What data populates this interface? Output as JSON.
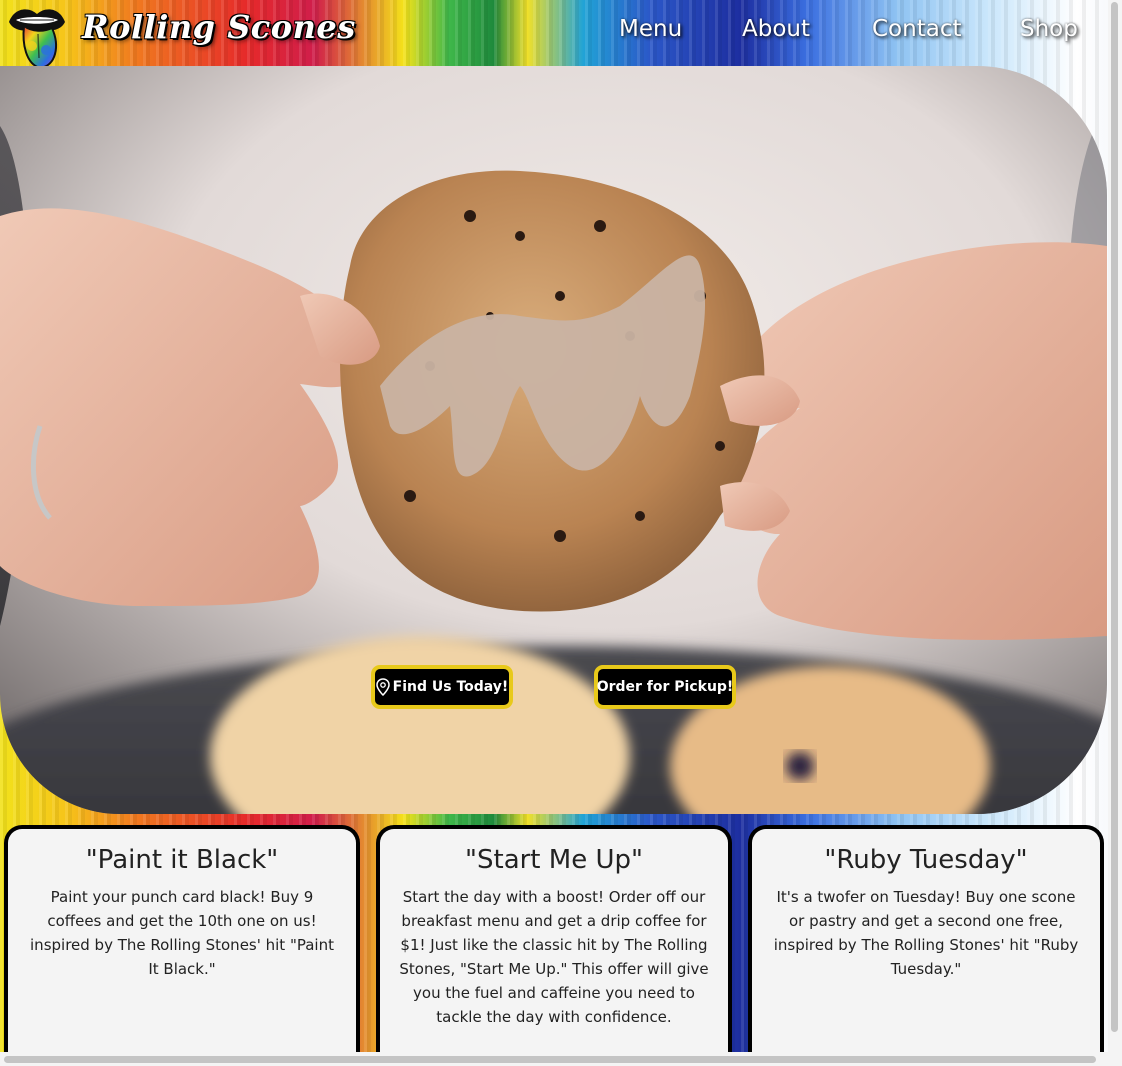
{
  "brand": {
    "name": "Rolling Scones",
    "logo_icon": "rainbow-tongue-logo-icon"
  },
  "nav": {
    "items": [
      {
        "label": "Menu"
      },
      {
        "label": "About"
      },
      {
        "label": "Contact"
      },
      {
        "label": "Shop"
      }
    ]
  },
  "hero": {
    "image": "hands-breaking-glazed-scone-photo",
    "find_button": {
      "label": "Find Us Today!",
      "icon": "map-pin-icon"
    },
    "order_button": {
      "label": "Order for Pickup!"
    }
  },
  "cards": [
    {
      "title": "\"Paint it Black\"",
      "body": "Paint your punch card black! Buy 9 coffees and get the 10th one on us! inspired by The Rolling Stones' hit \"Paint It Black.\""
    },
    {
      "title": "\"Start Me Up\"",
      "body": "Start the day with a boost! Order off our breakfast menu and get a drip coffee for $1! Just like the classic hit by The Rolling Stones, \"Start Me Up.\" This offer will give you the fuel and caffeine you need to tackle the day with confidence."
    },
    {
      "title": "\"Ruby Tuesday\"",
      "body": "It's a twofer on Tuesday! Buy one scone or pastry and get a second one free, inspired by The Rolling Stones' hit \"Ruby Tuesday.\""
    }
  ],
  "colors": {
    "button_bg": "#000000",
    "button_border": "#e8c91a",
    "card_bg": "#f4f4f4",
    "card_border": "#000000"
  }
}
